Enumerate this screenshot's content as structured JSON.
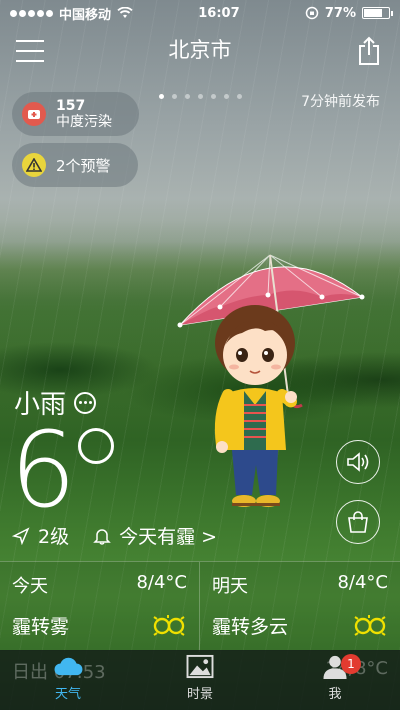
{
  "status_bar": {
    "carrier": "中国移动",
    "time": "16:07",
    "battery": "77%",
    "battery_level": 0.77
  },
  "header": {
    "city": "北京市",
    "page_count": 7,
    "active_page": 1
  },
  "published": "7分钟前发布",
  "air_quality": {
    "value": "157",
    "label": "中度污染",
    "color": "#e25a4e"
  },
  "warning": {
    "label": "2个预警",
    "color": "#e9d53c"
  },
  "current": {
    "condition": "小雨",
    "temperature": "6",
    "wind": "2级",
    "notice": "今天有霾 >"
  },
  "forecast": {
    "today": {
      "day": "今天",
      "temp": "8/4°C",
      "condition": "霾转雾",
      "icon": "haze-icon"
    },
    "tomorrow": {
      "day": "明天",
      "temp": "8/4°C",
      "condition": "霾转多云",
      "icon": "haze-icon"
    }
  },
  "tabbar": {
    "tabs": [
      {
        "label": "天气",
        "icon": "cloud-icon",
        "active": true
      },
      {
        "label": "时景",
        "icon": "photo-icon",
        "active": false
      },
      {
        "label": "我",
        "icon": "user-icon",
        "active": false,
        "badge": "1"
      }
    ],
    "ghost_left": "日出 07:53",
    "ghost_right": "24/8°C"
  },
  "colors": {
    "accent": "#41b7f1",
    "haze_icon": "#f0e000",
    "badge": "#e23b30"
  }
}
